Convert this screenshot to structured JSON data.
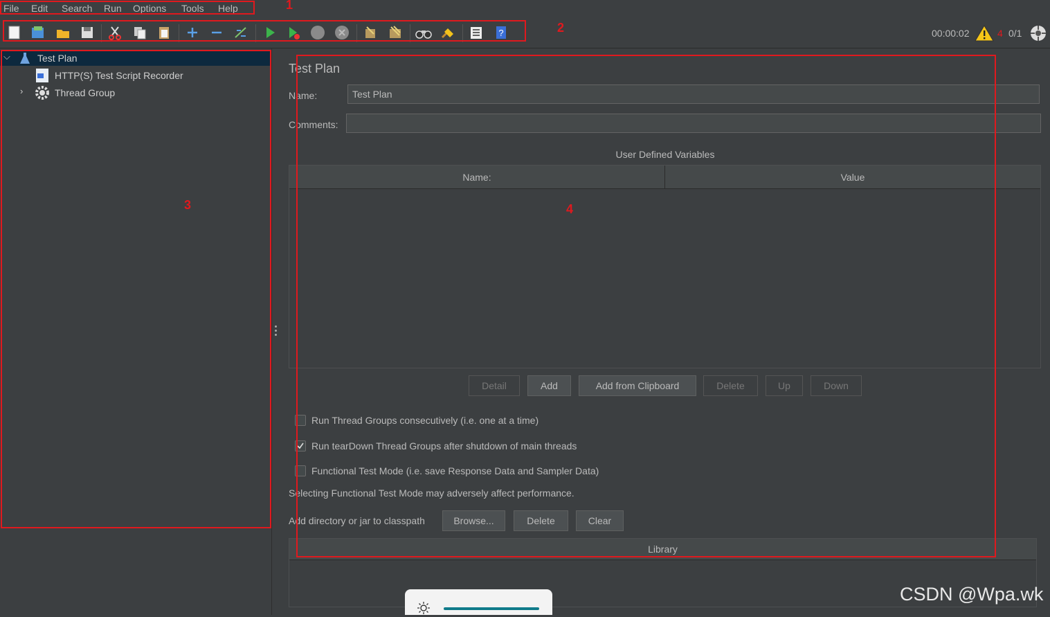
{
  "menu": [
    "File",
    "Edit",
    "Search",
    "Run",
    "Options",
    "Tools",
    "Help"
  ],
  "status": {
    "timer": "00:00:02",
    "warning_count": "4",
    "threads": "0/1"
  },
  "tree": {
    "root": "Test Plan",
    "children": [
      "HTTP(S) Test Script Recorder",
      "Thread Group"
    ]
  },
  "editor": {
    "title": "Test Plan",
    "name_label": "Name:",
    "name_value": "Test Plan",
    "comments_label": "Comments:",
    "comments_value": "",
    "udv_title": "User Defined Variables",
    "col_name": "Name:",
    "col_value": "Value",
    "buttons": {
      "detail": "Detail",
      "add": "Add",
      "add_clipboard": "Add from Clipboard",
      "delete": "Delete",
      "up": "Up",
      "down": "Down"
    },
    "cb1": "Run Thread Groups consecutively (i.e. one at a time)",
    "cb1_checked": false,
    "cb2": "Run tearDown Thread Groups after shutdown of main threads",
    "cb2_checked": true,
    "cb3": "Functional Test Mode (i.e. save Response Data and Sampler Data)",
    "cb3_checked": false,
    "functional_note": "Selecting Functional Test Mode may adversely affect performance.",
    "classpath_label": "Add directory or jar to classpath",
    "browse": "Browse...",
    "cp_delete": "Delete",
    "cp_clear": "Clear",
    "library": "Library"
  },
  "annotations": [
    "1",
    "2",
    "3",
    "4"
  ],
  "watermark": "CSDN @Wpa.wk",
  "colors": {
    "accent_red": "#e0191e",
    "selection": "#0d293e",
    "background": "#3c3f41"
  }
}
